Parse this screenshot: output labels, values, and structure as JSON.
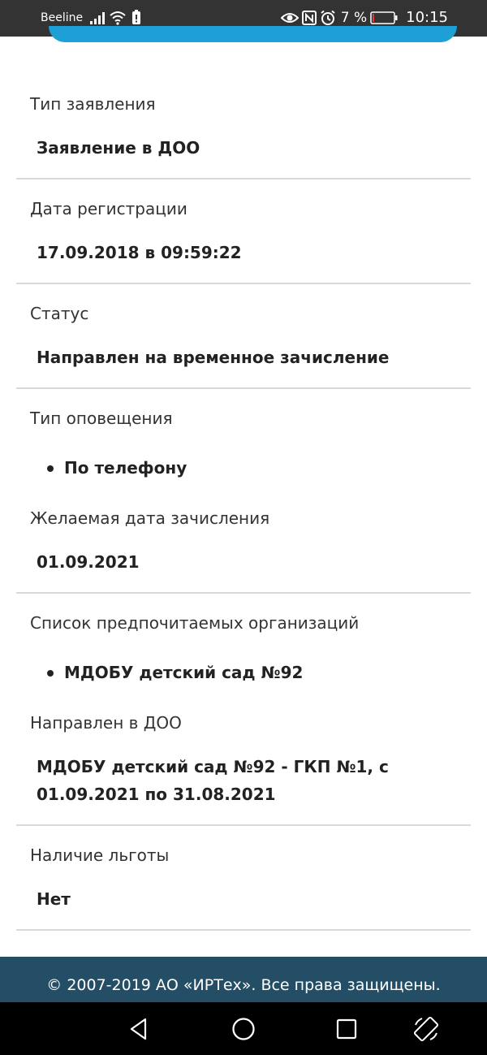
{
  "status_bar": {
    "carrier": "Beeline",
    "battery_percent": "7 %",
    "time": "10:15",
    "icons": [
      "signal-icon",
      "wifi-icon",
      "sim-icon",
      "eye-icon",
      "nfc-icon",
      "alarm-icon",
      "battery-icon"
    ],
    "battery_level": 0.07,
    "battery_color": "#e53935"
  },
  "accent_color": "#1e9fd6",
  "application": {
    "sections": [
      {
        "label": "Тип заявления",
        "value": "Заявление в ДОО"
      },
      {
        "label": "Дата регистрации",
        "value": "17.09.2018 в 09:59:22"
      },
      {
        "label": "Статус",
        "value": "Направлен на временное зачисление"
      },
      {
        "label": "Тип оповещения",
        "items": [
          "По телефону"
        ]
      },
      {
        "label": "Желаемая дата зачисления",
        "value": "01.09.2021"
      },
      {
        "label": "Список предпочитаемых организаций",
        "items": [
          "МДОБУ детский сад №92"
        ]
      },
      {
        "label": "Направлен в ДОО",
        "value": "МДОБУ детский сад №92 - ГКП №1, с 01.09.2021 по 31.08.2021"
      },
      {
        "label": "Наличие льготы",
        "value": "Нет"
      }
    ]
  },
  "footer": {
    "text": "© 2007-2019 АО «ИРТех». Все права защищены.",
    "background": "#244e66"
  },
  "nav_bar": {
    "icons": [
      "back-icon",
      "home-icon",
      "recents-icon",
      "rotate-icon"
    ]
  }
}
